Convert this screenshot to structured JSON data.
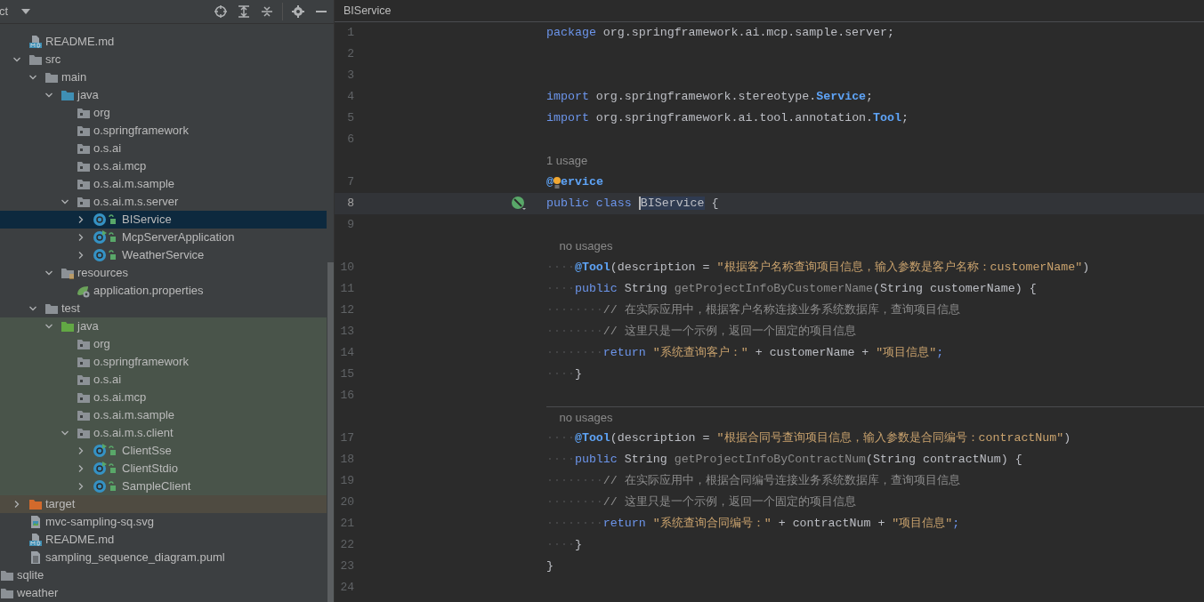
{
  "project_panel": {
    "title": "ct",
    "toolbar": [
      {
        "kind": "locate"
      },
      {
        "kind": "expand_all"
      },
      {
        "kind": "collapse_all"
      },
      {
        "kind": "settings"
      },
      {
        "kind": "hide"
      }
    ]
  },
  "tree": {
    "project_items": [
      {
        "label": "README.md",
        "kind": "md",
        "selected": false
      },
      {
        "label": "src",
        "kind": "folder",
        "expanded": true,
        "selected": false,
        "children": [
          {
            "label": "main",
            "kind": "folder",
            "expanded": true,
            "selected": false,
            "children": [
              {
                "label": "java",
                "kind": "source_root",
                "expanded": true,
                "selected": false,
                "children": [
                  {
                    "label": "org",
                    "kind": "package",
                    "selected": false
                  },
                  {
                    "label": "o.springframework",
                    "kind": "package",
                    "selected": false
                  },
                  {
                    "label": "o.s.ai",
                    "kind": "package",
                    "selected": false
                  },
                  {
                    "label": "o.s.ai.mcp",
                    "kind": "package",
                    "selected": false
                  },
                  {
                    "label": "o.s.ai.m.sample",
                    "kind": "package",
                    "selected": false
                  },
                  {
                    "label": "o.s.ai.m.s.server",
                    "kind": "package",
                    "expanded": true,
                    "selected": false,
                    "children": [
                      {
                        "label": "BIService",
                        "kind": "class",
                        "expanded": false,
                        "selected": true
                      },
                      {
                        "label": "McpServerApplication",
                        "kind": "main_class",
                        "expanded": false,
                        "selected": false
                      },
                      {
                        "label": "WeatherService",
                        "kind": "class",
                        "expanded": false,
                        "selected": false
                      }
                    ]
                  }
                ]
              },
              {
                "label": "resources",
                "kind": "resources_root",
                "expanded": true,
                "selected": false,
                "children": [
                  {
                    "label": "application.properties",
                    "kind": "properties",
                    "selected": false
                  }
                ]
              }
            ]
          },
          {
            "label": "test",
            "kind": "folder",
            "expanded": true,
            "selected": false,
            "children": [
              {
                "label": "java",
                "kind": "test_root",
                "color": "#49544a",
                "expanded": true,
                "selected": false,
                "children": [
                  {
                    "label": "org",
                    "kind": "package",
                    "selected": false
                  },
                  {
                    "label": "o.springframework",
                    "kind": "package",
                    "selected": false
                  },
                  {
                    "label": "o.s.ai",
                    "kind": "package",
                    "selected": false
                  },
                  {
                    "label": "o.s.ai.mcp",
                    "kind": "package",
                    "selected": false
                  },
                  {
                    "label": "o.s.ai.m.sample",
                    "kind": "package",
                    "selected": false
                  },
                  {
                    "label": "o.s.ai.m.s.client",
                    "kind": "package",
                    "expanded": true,
                    "selected": false,
                    "children": [
                      {
                        "label": "ClientSse",
                        "kind": "main_class",
                        "expanded": false,
                        "selected": false
                      },
                      {
                        "label": "ClientStdio",
                        "kind": "main_class",
                        "expanded": false,
                        "selected": false
                      },
                      {
                        "label": "SampleClient",
                        "kind": "class",
                        "expanded": false,
                        "selected": false
                      }
                    ]
                  }
                ]
              }
            ]
          }
        ]
      },
      {
        "label": "target",
        "kind": "excluded",
        "color": "#4f4b41",
        "expanded": false,
        "selected": false
      },
      {
        "label": "mvc-sampling-sq.svg",
        "kind": "svg",
        "selected": false
      },
      {
        "label": "README.md",
        "kind": "md",
        "selected": false
      },
      {
        "label": "sampling_sequence_diagram.puml",
        "kind": "text",
        "selected": false
      }
    ],
    "outer_items": [
      {
        "label": "sqlite",
        "kind": "folder",
        "selected": false
      },
      {
        "label": "weather",
        "kind": "folder",
        "selected": false
      }
    ]
  },
  "editor": {
    "tab": "BIService",
    "lines": [
      {
        "number": "1",
        "current": false,
        "tokens": [
          {
            "kind": "keyword",
            "text": "package"
          },
          {
            "kind": "plain",
            "text": " org.springframework.ai.mcp.sample.server;"
          }
        ]
      },
      {
        "number": "2",
        "current": false
      },
      {
        "number": "3",
        "current": false
      },
      {
        "number": "4",
        "current": false,
        "tokens": [
          {
            "kind": "keyword",
            "text": "import"
          },
          {
            "kind": "plain",
            "text": " org.springframework.stereotype."
          },
          {
            "kind": "type_ref",
            "text": "Service"
          },
          {
            "kind": "plain",
            "text": ";"
          }
        ]
      },
      {
        "number": "5",
        "current": false,
        "tokens": [
          {
            "kind": "keyword",
            "text": "import"
          },
          {
            "kind": "plain",
            "text": " org.springframework.ai.tool.annotation."
          },
          {
            "kind": "type_ref",
            "text": "Tool"
          },
          {
            "kind": "plain",
            "text": ";"
          }
        ]
      },
      {
        "number": "6",
        "current": false
      },
      {
        "kind": "hint",
        "separator": false,
        "text": "1 usage"
      },
      {
        "number": "7",
        "current": false,
        "tokens": [
          {
            "kind": "annotation",
            "text": "@"
          },
          {
            "kind": "bulb"
          },
          {
            "kind": "annotation",
            "text": "ervice"
          }
        ]
      },
      {
        "number": "8",
        "current": true,
        "spring_bean": true,
        "tokens": [
          {
            "kind": "keyword",
            "text": "public class "
          },
          {
            "kind": "selected_ref",
            "text": "BIService"
          },
          {
            "kind": "plain",
            "text": " {"
          }
        ]
      },
      {
        "number": "9",
        "current": false
      },
      {
        "kind": "hint",
        "separator": false,
        "text": "    no usages"
      },
      {
        "number": "10",
        "current": false,
        "tokens": [
          {
            "kind": "whitespace",
            "text": "····"
          },
          {
            "kind": "annotation",
            "text": "@Tool"
          },
          {
            "kind": "plain",
            "text": "(description = "
          },
          {
            "kind": "string",
            "text": "\"根据客户名称查询项目信息，输入参数是客户名称：customerName\""
          },
          {
            "kind": "plain",
            "text": ")"
          }
        ]
      },
      {
        "number": "11",
        "current": false,
        "tokens": [
          {
            "kind": "whitespace",
            "text": "····"
          },
          {
            "kind": "keyword",
            "text": "public"
          },
          {
            "kind": "plain",
            "text": " String "
          },
          {
            "kind": "unused",
            "text": "getProjectInfoByCustomerName"
          },
          {
            "kind": "plain",
            "text": "(String customerName) {"
          }
        ]
      },
      {
        "number": "12",
        "current": false,
        "tokens": [
          {
            "kind": "whitespace",
            "text": "········"
          },
          {
            "kind": "comment",
            "text": "// 在实际应用中，根据客户名称连接业务系统数据库，查询项目信息"
          }
        ]
      },
      {
        "number": "13",
        "current": false,
        "tokens": [
          {
            "kind": "whitespace",
            "text": "········"
          },
          {
            "kind": "comment",
            "text": "// 这里只是一个示例，返回一个固定的项目信息"
          }
        ]
      },
      {
        "number": "14",
        "current": false,
        "tokens": [
          {
            "kind": "whitespace",
            "text": "········"
          },
          {
            "kind": "keyword",
            "text": "return"
          },
          {
            "kind": "string",
            "text": " \"系统查询客户：\""
          },
          {
            "kind": "plain",
            "text": " + customerName + "
          },
          {
            "kind": "string",
            "text": "\"项目信息\""
          },
          {
            "kind": "keyword",
            "text": ";"
          }
        ]
      },
      {
        "number": "15",
        "current": false,
        "tokens": [
          {
            "kind": "whitespace",
            "text": "····"
          },
          {
            "kind": "plain",
            "text": "}"
          }
        ]
      },
      {
        "number": "16",
        "current": false
      },
      {
        "kind": "hint",
        "separator": true,
        "text": "    no usages"
      },
      {
        "number": "17",
        "current": false,
        "tokens": [
          {
            "kind": "whitespace",
            "text": "····"
          },
          {
            "kind": "annotation",
            "text": "@Tool"
          },
          {
            "kind": "plain",
            "text": "(description = "
          },
          {
            "kind": "string",
            "text": "\"根据合同号查询项目信息，输入参数是合同编号：contractNum\""
          },
          {
            "kind": "plain",
            "text": ")"
          }
        ]
      },
      {
        "number": "18",
        "current": false,
        "tokens": [
          {
            "kind": "whitespace",
            "text": "····"
          },
          {
            "kind": "keyword",
            "text": "public"
          },
          {
            "kind": "plain",
            "text": " String "
          },
          {
            "kind": "unused",
            "text": "getProjectInfoByContractNum"
          },
          {
            "kind": "plain",
            "text": "(String contractNum) {"
          }
        ]
      },
      {
        "number": "19",
        "current": false,
        "tokens": [
          {
            "kind": "whitespace",
            "text": "········"
          },
          {
            "kind": "comment",
            "text": "// 在实际应用中，根据合同编号连接业务系统数据库，查询项目信息"
          }
        ]
      },
      {
        "number": "20",
        "current": false,
        "tokens": [
          {
            "kind": "whitespace",
            "text": "········"
          },
          {
            "kind": "comment",
            "text": "// 这里只是一个示例，返回一个固定的项目信息"
          }
        ]
      },
      {
        "number": "21",
        "current": false,
        "tokens": [
          {
            "kind": "whitespace",
            "text": "········"
          },
          {
            "kind": "keyword",
            "text": "return"
          },
          {
            "kind": "string",
            "text": " \"系统查询合同编号：\""
          },
          {
            "kind": "plain",
            "text": " + contractNum + "
          },
          {
            "kind": "string",
            "text": "\"项目信息\""
          },
          {
            "kind": "keyword",
            "text": ";"
          }
        ]
      },
      {
        "number": "22",
        "current": false,
        "tokens": [
          {
            "kind": "whitespace",
            "text": "····"
          },
          {
            "kind": "plain",
            "text": "}"
          }
        ]
      },
      {
        "number": "23",
        "current": false,
        "tokens": [
          {
            "kind": "plain",
            "text": "}"
          }
        ]
      },
      {
        "number": "24",
        "current": false
      }
    ]
  }
}
